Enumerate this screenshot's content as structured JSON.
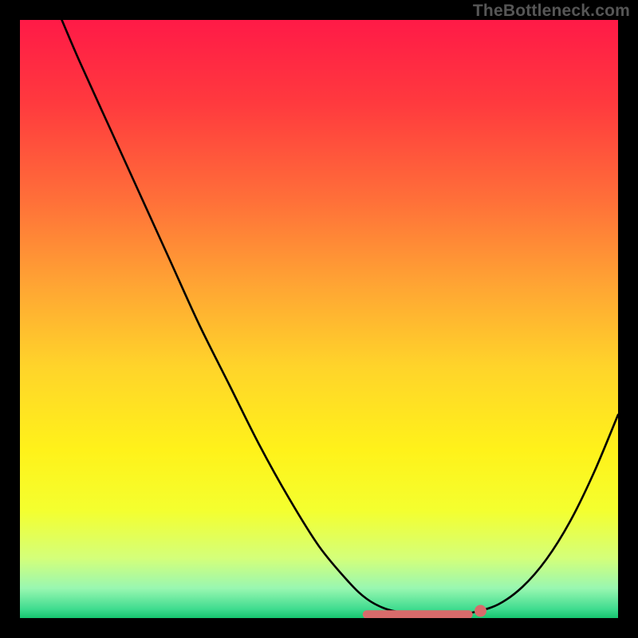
{
  "watermark": "TheBottleneck.com",
  "chart_data": {
    "type": "line",
    "title": "",
    "xlabel": "",
    "ylabel": "",
    "xlim": [
      0,
      100
    ],
    "ylim": [
      0,
      100
    ],
    "gradient_stops": [
      {
        "offset": 0.0,
        "color": "#ff1a47"
      },
      {
        "offset": 0.14,
        "color": "#ff3a3e"
      },
      {
        "offset": 0.3,
        "color": "#ff6f39"
      },
      {
        "offset": 0.45,
        "color": "#ffa733"
      },
      {
        "offset": 0.58,
        "color": "#ffd42a"
      },
      {
        "offset": 0.72,
        "color": "#fff21a"
      },
      {
        "offset": 0.82,
        "color": "#f4ff2f"
      },
      {
        "offset": 0.9,
        "color": "#d4ff7a"
      },
      {
        "offset": 0.95,
        "color": "#99f7b1"
      },
      {
        "offset": 0.985,
        "color": "#3fdc8f"
      },
      {
        "offset": 1.0,
        "color": "#16c56f"
      }
    ],
    "series": [
      {
        "name": "bottleneck-curve",
        "x": [
          7,
          10,
          15,
          20,
          25,
          30,
          35,
          40,
          45,
          50,
          55,
          58,
          61,
          64,
          67,
          70,
          73,
          76,
          80,
          84,
          88,
          92,
          96,
          100
        ],
        "y": [
          100,
          93,
          82,
          71,
          60,
          49,
          39,
          29,
          20,
          12,
          6,
          3.2,
          1.6,
          0.9,
          0.6,
          0.5,
          0.6,
          1.0,
          2.3,
          5.2,
          9.8,
          16.2,
          24.4,
          34.0
        ]
      }
    ],
    "flat_band": {
      "name": "optimal-range",
      "color": "#d86b6b",
      "x_start": 58,
      "x_end": 75,
      "y": 0.6
    },
    "flat_dot": {
      "color": "#d86b6b",
      "x": 77,
      "y": 1.2,
      "r": 1.0
    }
  }
}
